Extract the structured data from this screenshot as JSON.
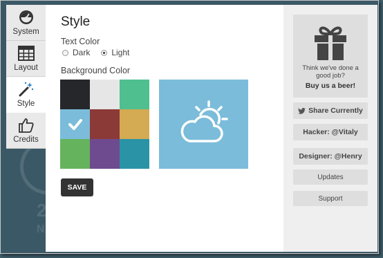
{
  "tabs": [
    {
      "label": "System",
      "icon": "gauge-icon"
    },
    {
      "label": "Layout",
      "icon": "grid-icon"
    },
    {
      "label": "Style",
      "icon": "magic-wand-icon"
    },
    {
      "label": "Credits",
      "icon": "thumbs-up-icon"
    }
  ],
  "active_tab": "Style",
  "main": {
    "title": "Style",
    "text_color_label": "Text Color",
    "text_color_options": [
      {
        "label": "Dark",
        "selected": false
      },
      {
        "label": "Light",
        "selected": true
      }
    ],
    "bg_color_label": "Background Color",
    "swatches": [
      {
        "color": "#25272a",
        "selected": false
      },
      {
        "color": "#e6e6e6",
        "selected": false
      },
      {
        "color": "#4fbf8f",
        "selected": false
      },
      {
        "color": "#7bbcda",
        "selected": true
      },
      {
        "color": "#8c3a38",
        "selected": false
      },
      {
        "color": "#d4aa52",
        "selected": false
      },
      {
        "color": "#66b35e",
        "selected": false
      },
      {
        "color": "#6e4b8e",
        "selected": false
      },
      {
        "color": "#2a93a6",
        "selected": false
      }
    ],
    "preview_color": "#7bbcda",
    "preview_icon": "partly-cloudy-icon",
    "save_label": "SAVE"
  },
  "sidebar": {
    "promo_icon": "gift-icon",
    "promo_text": "Think we've done a good job?",
    "promo_cta": "Buy us a beer!",
    "share_label": "Share Currently",
    "share_icon": "twitter-bird-icon",
    "hacker_label": "Hacker: @Vitaly",
    "designer_label": "Designer: @Henry",
    "updates_label": "Updates",
    "support_label": "Support"
  },
  "background": {
    "text_large": "2",
    "text_small": "N"
  }
}
